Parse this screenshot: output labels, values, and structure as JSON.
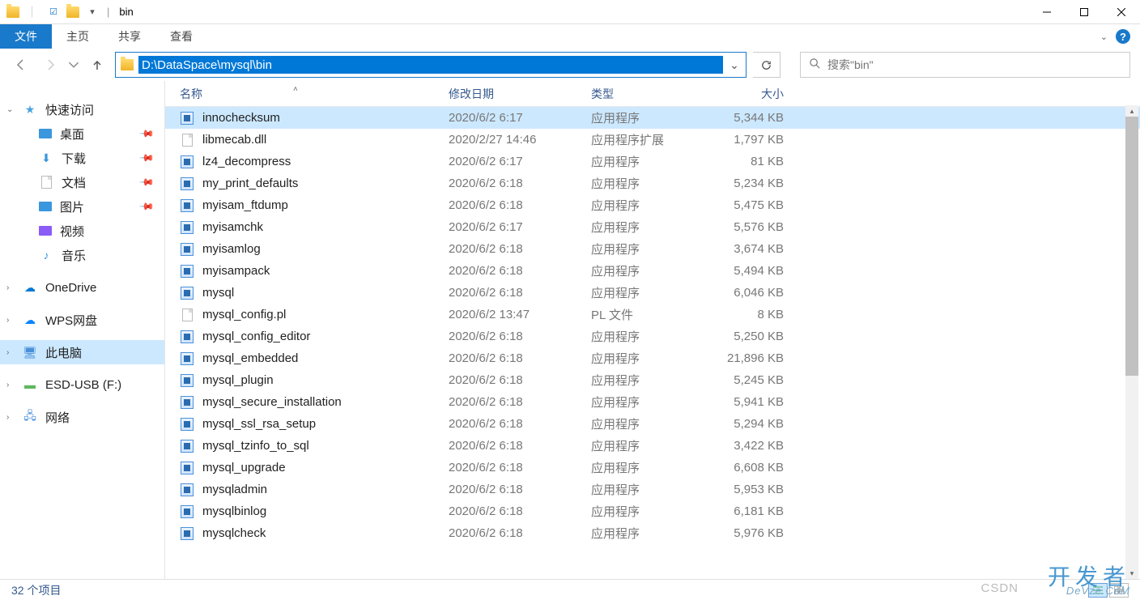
{
  "title": {
    "window": "bin"
  },
  "ribbon": {
    "file": "文件",
    "home": "主页",
    "share": "共享",
    "view": "查看"
  },
  "nav": {
    "path": "D:\\DataSpace\\mysql\\bin",
    "search_placeholder": "搜索\"bin\""
  },
  "sidebar": {
    "quick": "快速访问",
    "desktop": "桌面",
    "downloads": "下载",
    "documents": "文档",
    "pictures": "图片",
    "videos": "视频",
    "music": "音乐",
    "onedrive": "OneDrive",
    "wps": "WPS网盘",
    "thispc": "此电脑",
    "esd": "ESD-USB (F:)",
    "network": "网络"
  },
  "columns": {
    "name": "名称",
    "date": "修改日期",
    "type": "类型",
    "size": "大小"
  },
  "type_labels": {
    "app": "应用程序",
    "dll": "应用程序扩展",
    "pl": "PL 文件"
  },
  "files": [
    {
      "name": "innochecksum",
      "date": "2020/6/2 6:17",
      "type": "app",
      "size": "5,344 KB",
      "selected": true
    },
    {
      "name": "libmecab.dll",
      "date": "2020/2/27 14:46",
      "type": "dll",
      "size": "1,797 KB"
    },
    {
      "name": "lz4_decompress",
      "date": "2020/6/2 6:17",
      "type": "app",
      "size": "81 KB"
    },
    {
      "name": "my_print_defaults",
      "date": "2020/6/2 6:18",
      "type": "app",
      "size": "5,234 KB"
    },
    {
      "name": "myisam_ftdump",
      "date": "2020/6/2 6:18",
      "type": "app",
      "size": "5,475 KB"
    },
    {
      "name": "myisamchk",
      "date": "2020/6/2 6:17",
      "type": "app",
      "size": "5,576 KB"
    },
    {
      "name": "myisamlog",
      "date": "2020/6/2 6:18",
      "type": "app",
      "size": "3,674 KB"
    },
    {
      "name": "myisampack",
      "date": "2020/6/2 6:18",
      "type": "app",
      "size": "5,494 KB"
    },
    {
      "name": "mysql",
      "date": "2020/6/2 6:18",
      "type": "app",
      "size": "6,046 KB"
    },
    {
      "name": "mysql_config.pl",
      "date": "2020/6/2 13:47",
      "type": "pl",
      "size": "8 KB"
    },
    {
      "name": "mysql_config_editor",
      "date": "2020/6/2 6:18",
      "type": "app",
      "size": "5,250 KB"
    },
    {
      "name": "mysql_embedded",
      "date": "2020/6/2 6:18",
      "type": "app",
      "size": "21,896 KB"
    },
    {
      "name": "mysql_plugin",
      "date": "2020/6/2 6:18",
      "type": "app",
      "size": "5,245 KB"
    },
    {
      "name": "mysql_secure_installation",
      "date": "2020/6/2 6:18",
      "type": "app",
      "size": "5,941 KB"
    },
    {
      "name": "mysql_ssl_rsa_setup",
      "date": "2020/6/2 6:18",
      "type": "app",
      "size": "5,294 KB"
    },
    {
      "name": "mysql_tzinfo_to_sql",
      "date": "2020/6/2 6:18",
      "type": "app",
      "size": "3,422 KB"
    },
    {
      "name": "mysql_upgrade",
      "date": "2020/6/2 6:18",
      "type": "app",
      "size": "6,608 KB"
    },
    {
      "name": "mysqladmin",
      "date": "2020/6/2 6:18",
      "type": "app",
      "size": "5,953 KB"
    },
    {
      "name": "mysqlbinlog",
      "date": "2020/6/2 6:18",
      "type": "app",
      "size": "6,181 KB"
    },
    {
      "name": "mysqlcheck",
      "date": "2020/6/2 6:18",
      "type": "app",
      "size": "5,976 KB"
    }
  ],
  "status": {
    "items": "32 个项目"
  },
  "watermark": {
    "big": "开发者",
    "small": "DeVze.CoM",
    "csdn": "CSDN"
  }
}
